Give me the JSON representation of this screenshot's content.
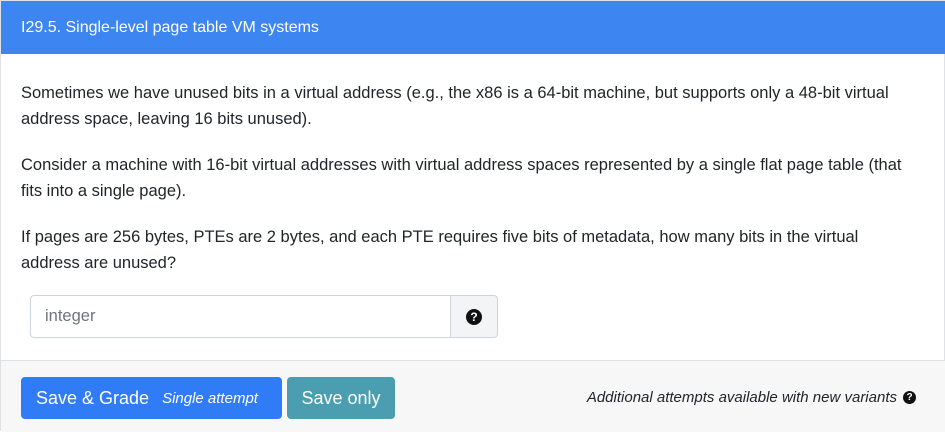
{
  "header": {
    "title": "I29.5. Single-level page table VM systems"
  },
  "question": {
    "paragraphs": [
      "Sometimes we have unused bits in a virtual address (e.g., the x86 is a 64-bit machine, but supports only a 48-bit virtual address space, leaving 16 bits unused).",
      "Consider a machine with 16-bit virtual addresses with virtual address spaces represented by a single flat page table (that fits into a single page).",
      "If pages are 256 bytes, PTEs are 2 bytes, and each PTE requires five bits of metadata, how many bits in the virtual address are unused?"
    ]
  },
  "answer_input": {
    "value": "",
    "placeholder": "integer",
    "help_icon": "question-circle-icon"
  },
  "footer": {
    "grade_button_label": "Save & Grade",
    "grade_button_sublabel": "Single attempt",
    "save_button_label": "Save only",
    "attempts_note": "Additional attempts available with new variants",
    "note_icon": "question-circle-icon"
  },
  "colors": {
    "header_bg": "#3d85f0",
    "grade_button_bg": "#2f7cf6",
    "save_button_bg": "#4a9eb0",
    "footer_bg": "#f7f7f8"
  }
}
